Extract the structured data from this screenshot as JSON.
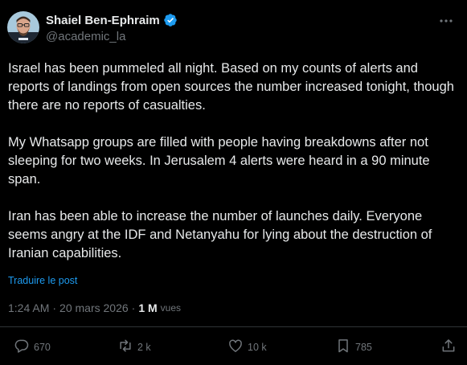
{
  "author": {
    "display_name": "Shaiel Ben-Ephraim",
    "handle": "@academic_la",
    "verified": true
  },
  "post": {
    "paragraphs": [
      "Israel has been pummeled all night. Based on my counts of alerts and reports of landings from open sources the number increased tonight, though there are no reports of casualties.",
      "My Whatsapp groups are filled with people having breakdowns after not sleeping for two weeks. In Jerusalem 4 alerts were heard in a 90 minute span.",
      "Iran has been able to increase the number of launches daily. Everyone seems angry at the IDF and Netanyahu for lying about the destruction of Iranian capabilities."
    ],
    "translate_label": "Traduire le post"
  },
  "meta": {
    "time": "1:24 AM",
    "date": "20 mars 2026",
    "separator": "·",
    "views_count": "1 M",
    "views_label": "vues"
  },
  "actions": {
    "replies": "670",
    "reposts": "2 k",
    "likes": "10 k",
    "bookmarks": "785"
  },
  "icons": {
    "verified": "verified-badge-icon",
    "more": "more-options-icon",
    "reply": "reply-icon",
    "repost": "repost-icon",
    "like": "heart-icon",
    "bookmark": "bookmark-icon",
    "share": "share-icon"
  },
  "colors": {
    "background": "#000000",
    "text": "#e7e9ea",
    "secondary_text": "#71767b",
    "accent": "#1d9bf0",
    "divider": "#2f3336"
  }
}
